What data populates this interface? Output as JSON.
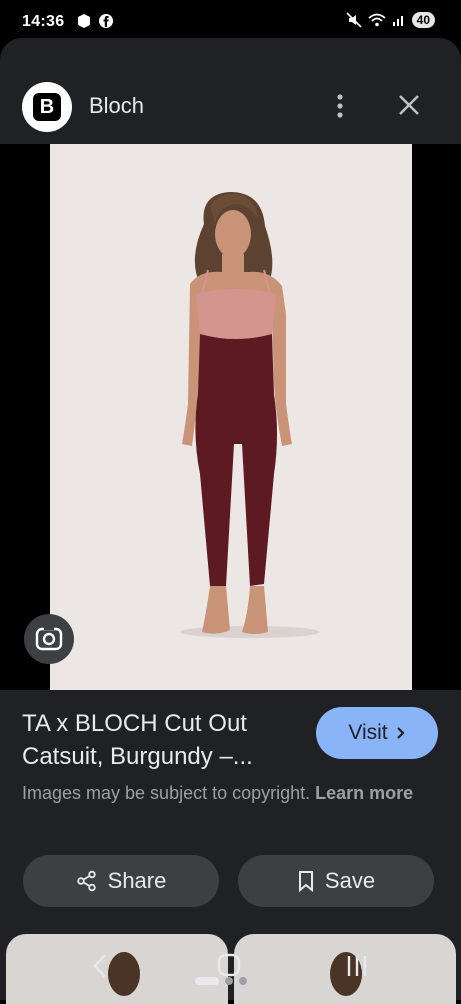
{
  "status_bar": {
    "time": "14:36",
    "battery": "40"
  },
  "header": {
    "site_name": "Bloch",
    "logo_letter": "B"
  },
  "result": {
    "title": "TA x BLOCH Cut Out Catsuit, Burgundy –...",
    "visit_label": "Visit",
    "copyright": "Images may be subject to copyright.",
    "learn_more": "Learn more"
  },
  "actions": {
    "share_label": "Share",
    "save_label": "Save"
  },
  "colors": {
    "accent": "#8ab4f8",
    "sheet": "#202124",
    "button": "#3c4043",
    "catsuit": "#5e1a22",
    "bra": "#d4958e"
  },
  "icons": [
    "mute-icon",
    "wifi-icon",
    "signal-icon",
    "more-vert-icon",
    "close-icon",
    "lens-icon",
    "share-icon",
    "bookmark-icon",
    "chevron-right-icon",
    "back-icon",
    "home-icon",
    "recents-icon"
  ]
}
